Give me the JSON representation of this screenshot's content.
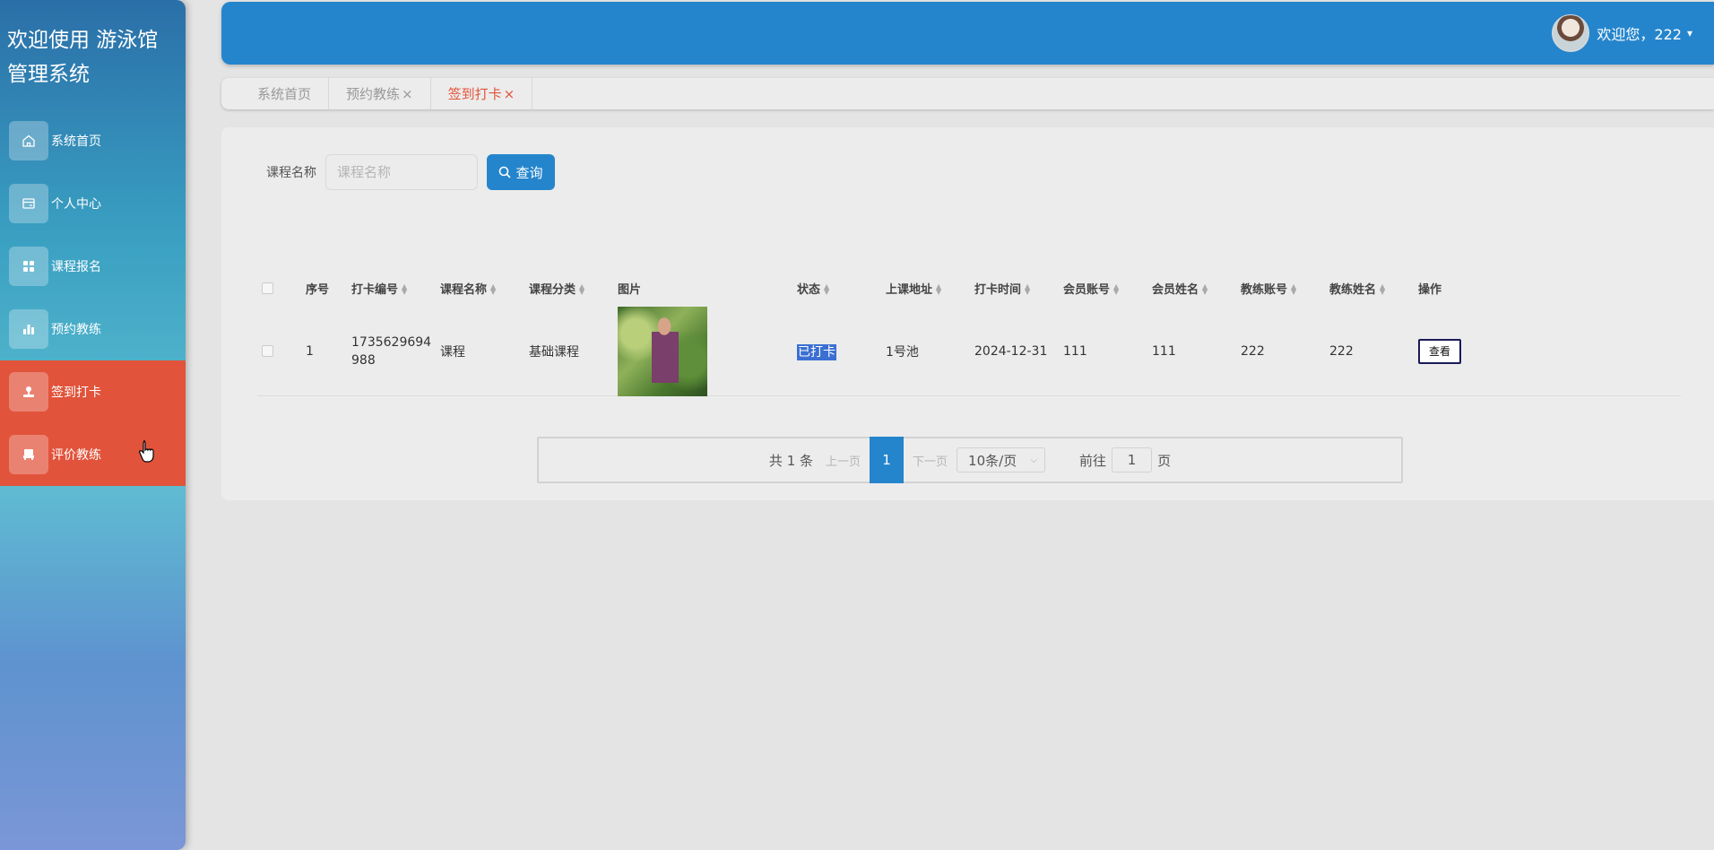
{
  "app": {
    "title": "欢迎使用 游泳馆管理系统"
  },
  "sidebar": {
    "items": [
      {
        "label": "系统首页",
        "icon": "home-icon"
      },
      {
        "label": "个人中心",
        "icon": "card-icon"
      },
      {
        "label": "课程报名",
        "icon": "grid-icon"
      },
      {
        "label": "预约教练",
        "icon": "bar-chart-icon"
      },
      {
        "label": "签到打卡",
        "icon": "stamp-icon",
        "active": true
      },
      {
        "label": "评价教练",
        "icon": "seat-icon",
        "active": true
      }
    ]
  },
  "header": {
    "welcome": "欢迎您，222",
    "caret": "▾"
  },
  "tabs": [
    {
      "label": "系统首页",
      "closable": false
    },
    {
      "label": "预约教练",
      "closable": true
    },
    {
      "label": "签到打卡",
      "closable": true,
      "active": true
    }
  ],
  "tab_close": "×",
  "search": {
    "label": "课程名称",
    "placeholder": "课程名称",
    "value": "",
    "button": "查询"
  },
  "table": {
    "headers": [
      "序号",
      "打卡编号",
      "课程名称",
      "课程分类",
      "图片",
      "状态",
      "上课地址",
      "打卡时间",
      "会员账号",
      "会员姓名",
      "教练账号",
      "教练姓名",
      "操作"
    ],
    "rows": [
      {
        "index": "1",
        "code": "1735629694988",
        "course": "课程",
        "category": "基础课程",
        "status": "已打卡",
        "address": "1号池",
        "time": "2024-12-31",
        "member_account": "111",
        "member_name": "111",
        "coach_account": "222",
        "coach_name": "222",
        "action": "查看"
      }
    ]
  },
  "pagination": {
    "total": "共 1 条",
    "prev": "上一页",
    "page": "1",
    "next": "下一页",
    "page_size": "10条/页",
    "goto_label": "前往",
    "goto_value": "1",
    "goto_unit": "页"
  },
  "colors": {
    "primary": "#2585cc",
    "active": "#e2533b"
  }
}
